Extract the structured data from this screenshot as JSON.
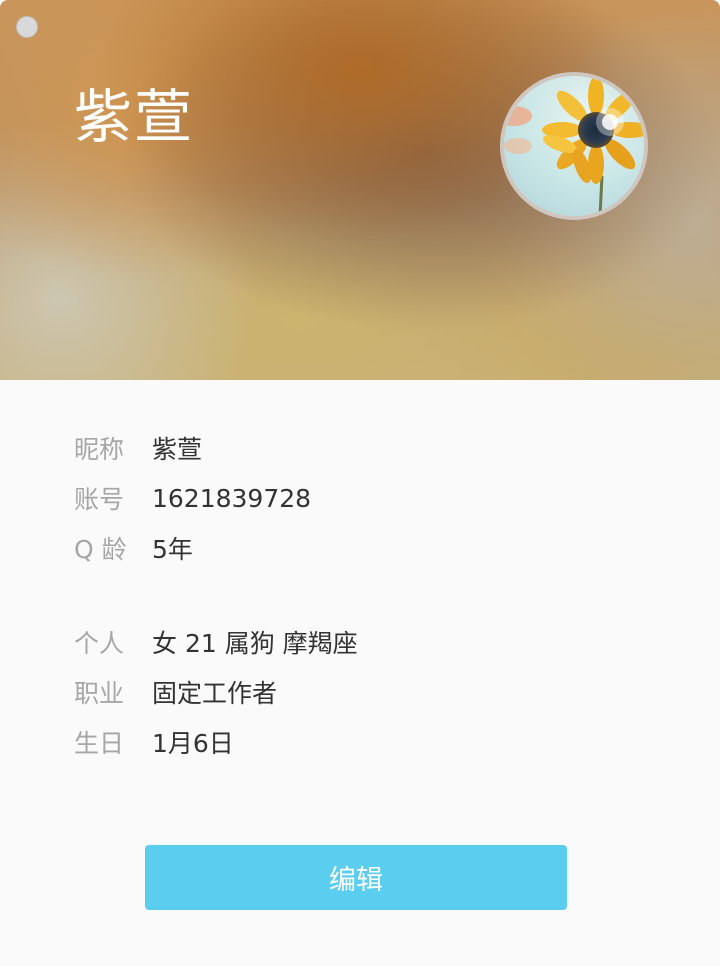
{
  "window": {
    "close_button": "close"
  },
  "header": {
    "display_name": "紫萱",
    "avatar_icon": "sunflower-avatar"
  },
  "profile": {
    "group1": [
      {
        "label": "昵称",
        "value": "紫萱"
      },
      {
        "label": "账号",
        "value": "1621839728"
      },
      {
        "label": "Q 龄",
        "value": "5年"
      }
    ],
    "group2": [
      {
        "label": "个人",
        "value": "女 21 属狗 摩羯座"
      },
      {
        "label": "职业",
        "value": "固定工作者"
      },
      {
        "label": "生日",
        "value": "1月6日"
      }
    ]
  },
  "actions": {
    "edit_label": "编辑",
    "edit_color": "#5bcdee"
  }
}
